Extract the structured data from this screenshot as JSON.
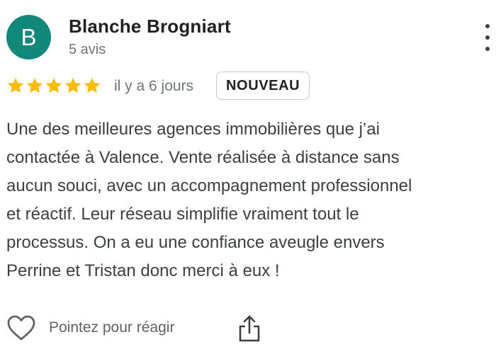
{
  "review": {
    "author": {
      "initial": "B",
      "name": "Blanche Brogniart",
      "review_count": "5 avis",
      "avatar_color": "#12887a"
    },
    "rating": 5,
    "rating_max": 5,
    "star_color": "#fbbc04",
    "time_ago": "il y a 6 jours",
    "badge": "NOUVEAU",
    "text_lines": [
      "Une des meilleures agences immobilières que j’ai",
      "contactée à Valence. Vente réalisée à distance sans",
      "aucun souci, avec un accompagnement professionnel",
      "et réactif. Leur réseau simplifie vraiment tout le",
      "processus. On a eu une confiance aveugle envers",
      "Perrine et Tristan donc merci à eux !"
    ],
    "more_icon": "more-vertical-icon"
  },
  "actions": {
    "like_icon": "heart-outline-icon",
    "like_label": "Pointez pour réagir",
    "share_icon": "share-icon"
  }
}
